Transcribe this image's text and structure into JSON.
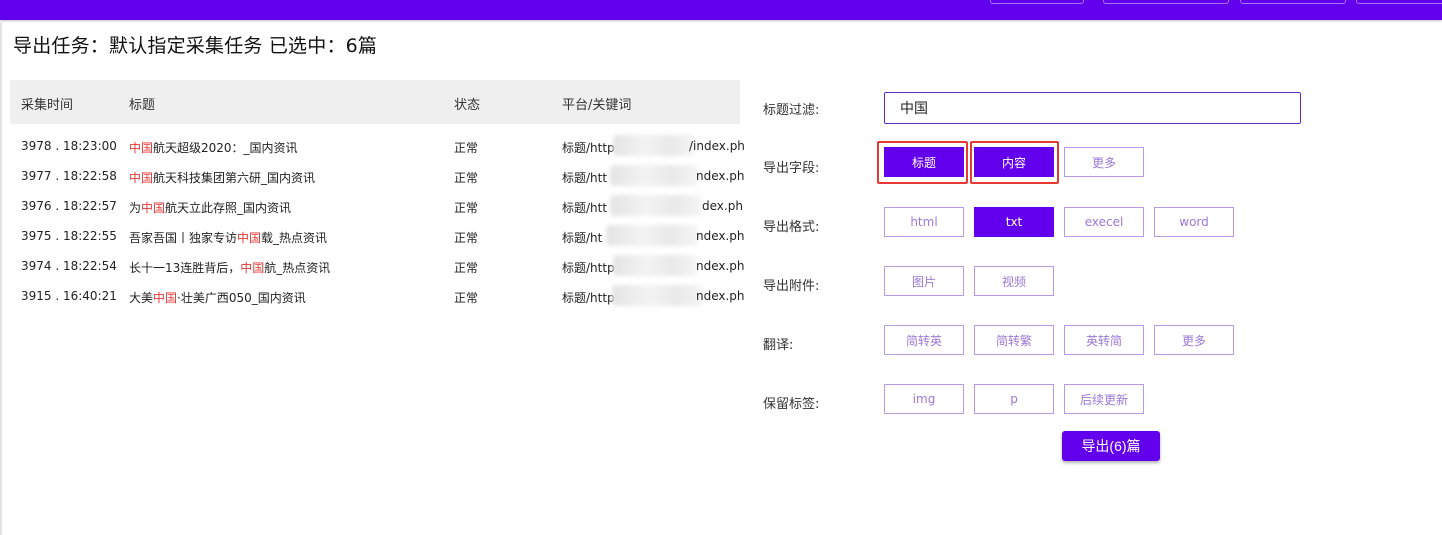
{
  "header": {
    "title": "导出任务：默认指定采集任务 已选中：6篇"
  },
  "table": {
    "columns": [
      "采集时间",
      "标题",
      "状态",
      "平台/关键词"
    ],
    "rows": [
      {
        "time": "3978 . 18:23:00",
        "title_pre": "",
        "title_hl": "中国",
        "title_post": "航天超级2020：_国内资讯",
        "status": "正常",
        "plat_pre": "标题/http",
        "plat_post": "/index.ph"
      },
      {
        "time": "3977 . 18:22:58",
        "title_pre": "",
        "title_hl": "中国",
        "title_post": "航天科技集团第六研_国内资讯",
        "status": "正常",
        "plat_pre": "标题/htt",
        "plat_post": "ndex.ph"
      },
      {
        "time": "3976 . 18:22:57",
        "title_pre": "为",
        "title_hl": "中国",
        "title_post": "航天立此存照_国内资讯",
        "status": "正常",
        "plat_pre": "标题/htt",
        "plat_post": "dex.ph"
      },
      {
        "time": "3975 . 18:22:55",
        "title_pre": "吾家吾国丨独家专访",
        "title_hl": "中国",
        "title_post": "载_热点资讯",
        "status": "正常",
        "plat_pre": "标题/ht",
        "plat_post": "ndex.ph"
      },
      {
        "time": "3974 . 18:22:54",
        "title_pre": "长十一13连胜背后，",
        "title_hl": "中国",
        "title_post": "航_热点资讯",
        "status": "正常",
        "plat_pre": "标题/http",
        "plat_post": "ndex.ph"
      },
      {
        "time": "3915 . 16:40:21",
        "title_pre": "大美",
        "title_hl": "中国",
        "title_post": "·壮美广西050_国内资讯",
        "status": "正常",
        "plat_pre": "标题/http",
        "plat_post": "ndex.ph"
      }
    ]
  },
  "form": {
    "filter_label": "标题过滤:",
    "filter_value": "中国",
    "fields_label": "导出字段:",
    "fields": [
      "标题",
      "内容",
      "更多"
    ],
    "format_label": "导出格式:",
    "formats": [
      "html",
      "txt",
      "execel",
      "word"
    ],
    "attach_label": "导出附件:",
    "attachments": [
      "图片",
      "视频"
    ],
    "translate_label": "翻译:",
    "translations": [
      "简转英",
      "简转繁",
      "英转简",
      "更多"
    ],
    "keep_label": "保留标签:",
    "tags": [
      "img",
      "p",
      "后续更新"
    ],
    "export_button": "导出(6)篇"
  },
  "colors": {
    "primary": "#6200ee",
    "highlight": "#e53935",
    "outline": "#b79ae6"
  }
}
